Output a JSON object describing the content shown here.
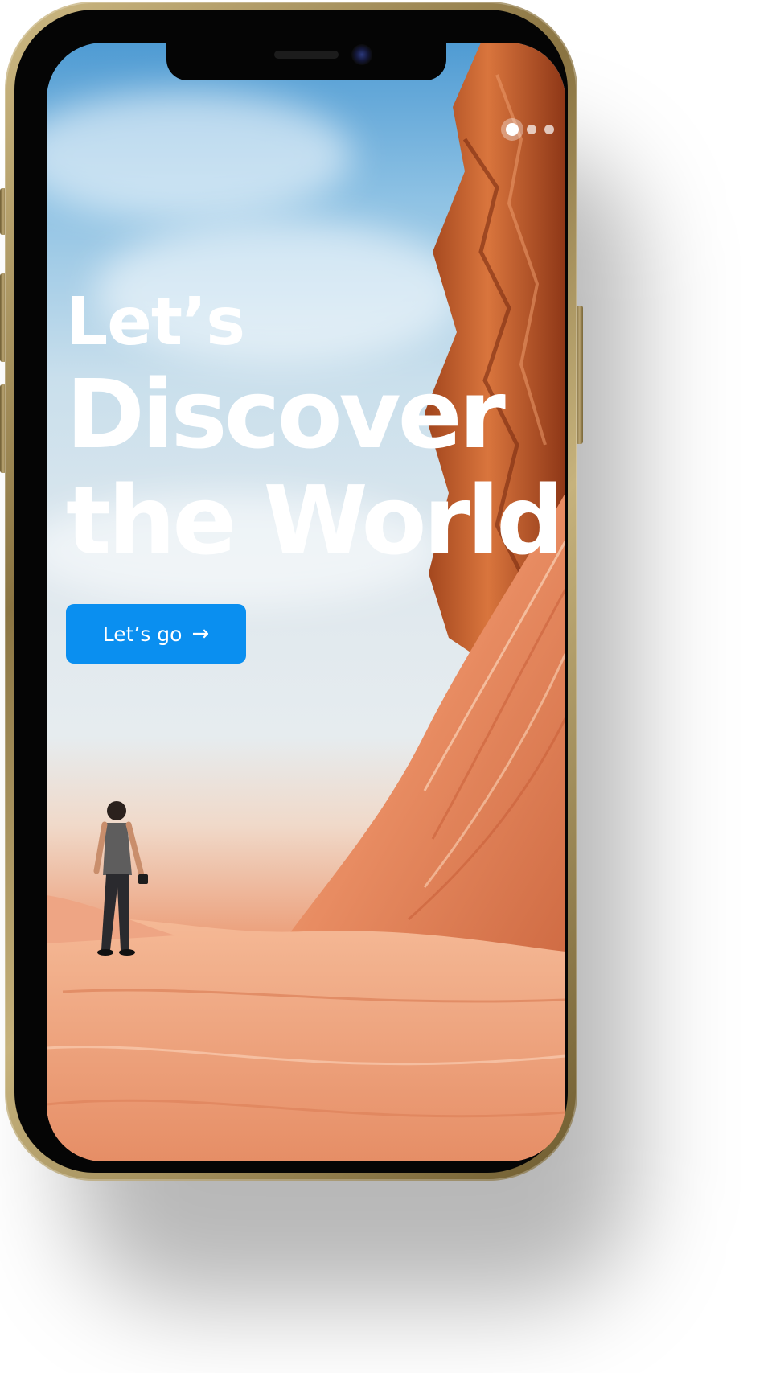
{
  "pager": {
    "total": 3,
    "active_index": 0
  },
  "hero": {
    "line1": "Let’s",
    "line2": "Discover",
    "line3": "the World."
  },
  "cta": {
    "label": "Let’s go",
    "icon": "arrow-right-icon"
  },
  "colors": {
    "accent": "#0a8ff0",
    "device_frame": "#b9a472",
    "text": "#ffffff"
  }
}
